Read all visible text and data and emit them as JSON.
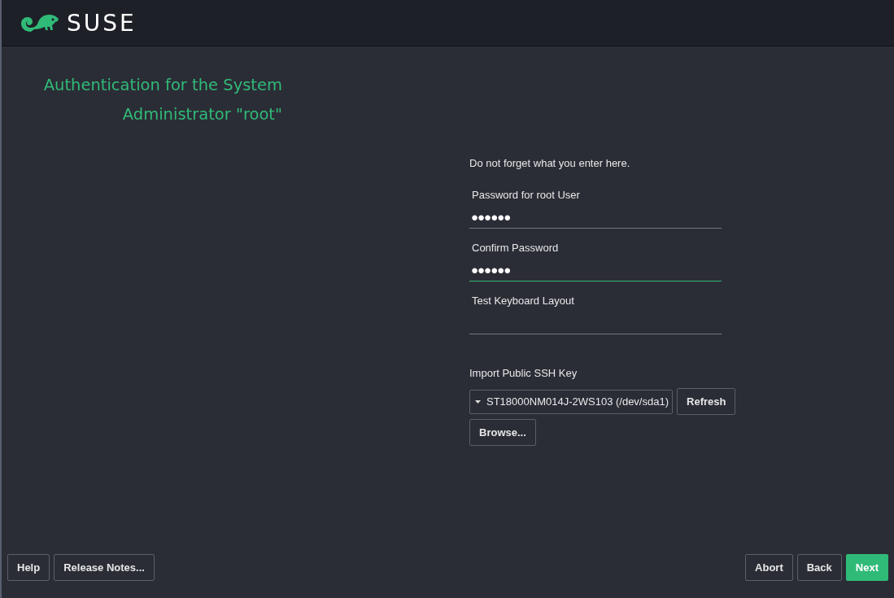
{
  "header": {
    "logo_text": "SUSE"
  },
  "title": "Authentication for the System Administrator \"root\"",
  "form": {
    "note": "Do not forget what you enter here.",
    "fields": [
      {
        "label": "Password for root User",
        "value": "●●●●●●",
        "focused": false
      },
      {
        "label": "Confirm Password",
        "value": "●●●●●●",
        "focused": true
      },
      {
        "label": "Test Keyboard Layout",
        "focused": false
      }
    ],
    "ssh_key": {
      "label": "Import Public SSH Key",
      "selected_device": "ST18000NM014J-2WS103 (/dev/sda1)",
      "refresh_button": "Refresh",
      "browse_button": "Browse..."
    }
  },
  "footer": {
    "left_buttons": [
      {
        "label": "Help",
        "kind": "normal"
      },
      {
        "label": "Release Notes...",
        "kind": "normal"
      }
    ],
    "right_buttons": [
      {
        "label": "Abort",
        "kind": "normal"
      },
      {
        "label": "Back",
        "kind": "normal"
      },
      {
        "label": "Next",
        "kind": "primary"
      }
    ]
  }
}
